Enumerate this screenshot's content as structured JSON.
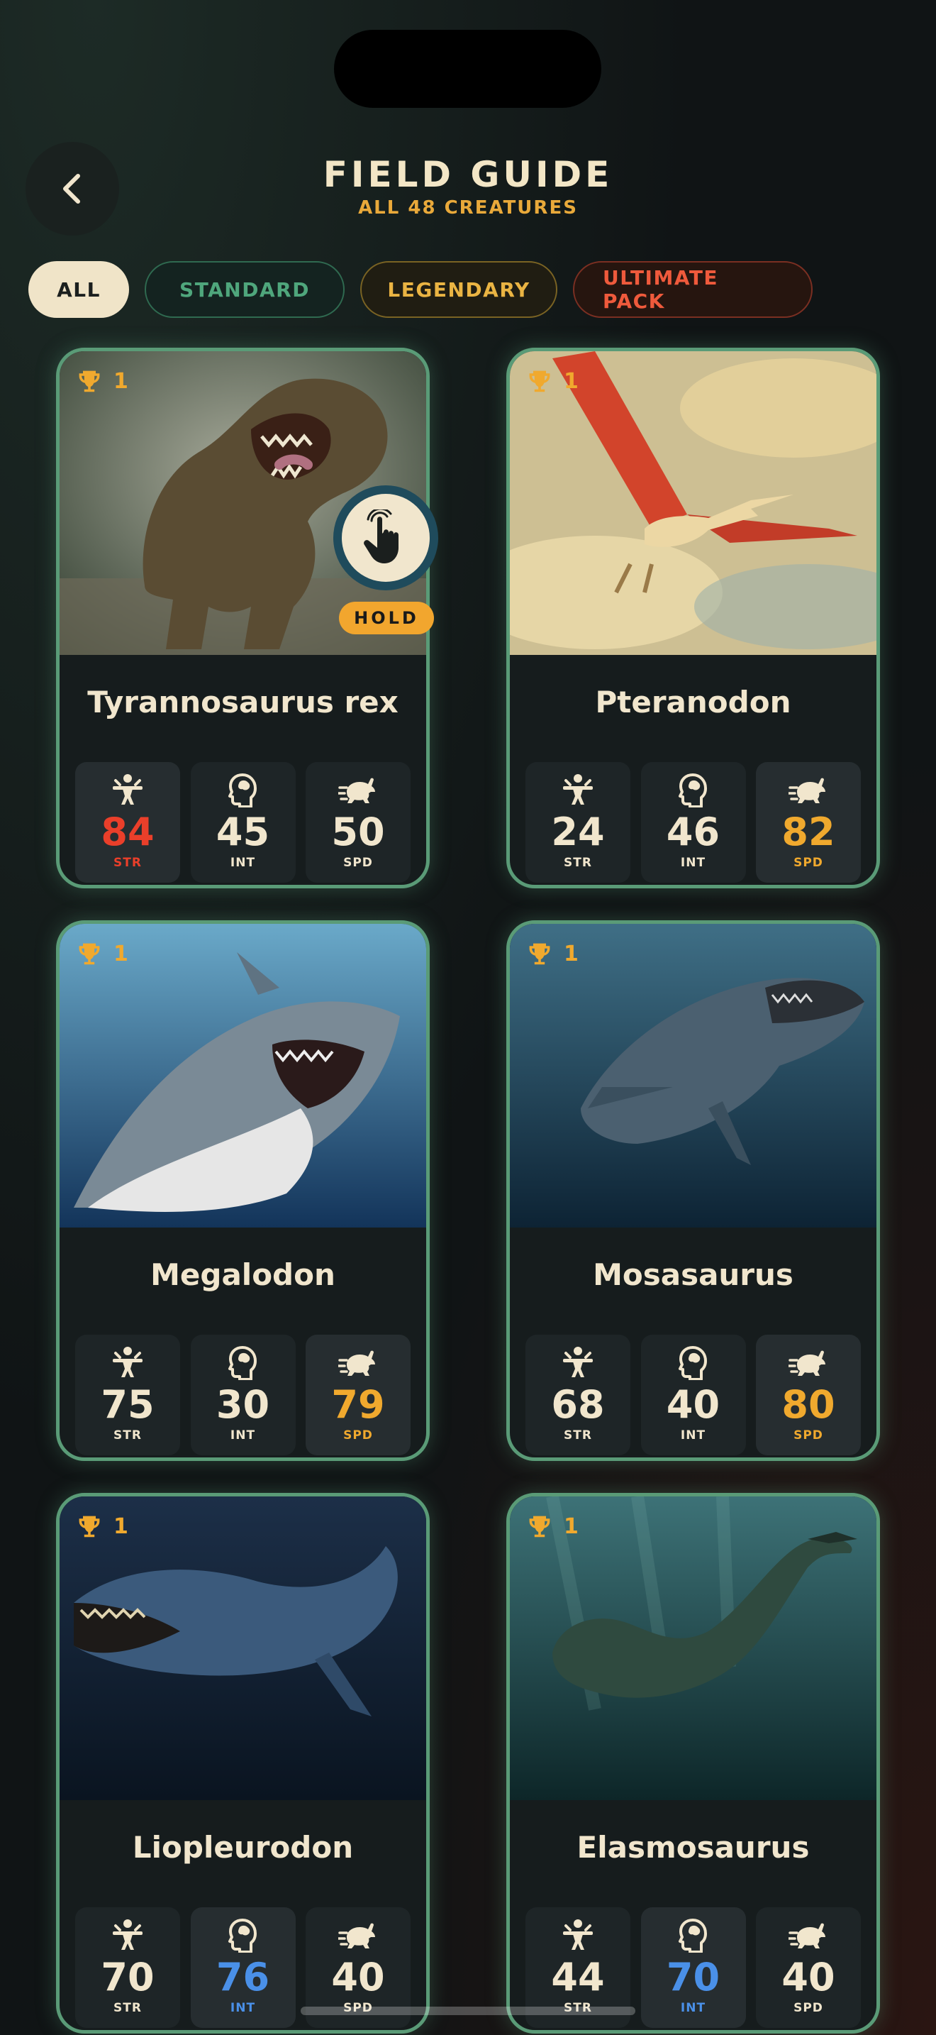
{
  "header": {
    "title": "FIELD GUIDE",
    "subtitle": "ALL 48 CREATURES",
    "back_icon": "chevron-left-icon"
  },
  "filters": [
    {
      "label": "ALL",
      "selected": true
    },
    {
      "label": "STANDARD",
      "selected": false
    },
    {
      "label": "LEGENDARY",
      "selected": false
    },
    {
      "label": "ULTIMATE PACK",
      "selected": false
    }
  ],
  "stat_labels": {
    "str": "STR",
    "int": "INT",
    "spd": "SPD"
  },
  "cards": [
    {
      "name": "Tyrannosaurus rex",
      "trophies": "1",
      "str": "84",
      "int": "45",
      "spd": "50"
    },
    {
      "name": "Pteranodon",
      "trophies": "1",
      "str": "24",
      "int": "46",
      "spd": "82"
    },
    {
      "name": "Megalodon",
      "trophies": "1",
      "str": "75",
      "int": "30",
      "spd": "79"
    },
    {
      "name": "Mosasaurus",
      "trophies": "1",
      "str": "68",
      "int": "40",
      "spd": "80"
    },
    {
      "name": "Liopleurodon",
      "trophies": "1",
      "str": "70",
      "int": "76",
      "spd": "40"
    },
    {
      "name": "Elasmosaurus",
      "trophies": "1",
      "str": "44",
      "int": "70",
      "spd": "40"
    }
  ],
  "hold_hint": {
    "label": "HOLD",
    "icon": "tap-hand-icon"
  },
  "colors": {
    "accent_green": "#5a9b77",
    "gold": "#f0a92e",
    "red": "#ea3f2a",
    "blue": "#4a90e8",
    "cream": "#f1e6cd"
  }
}
